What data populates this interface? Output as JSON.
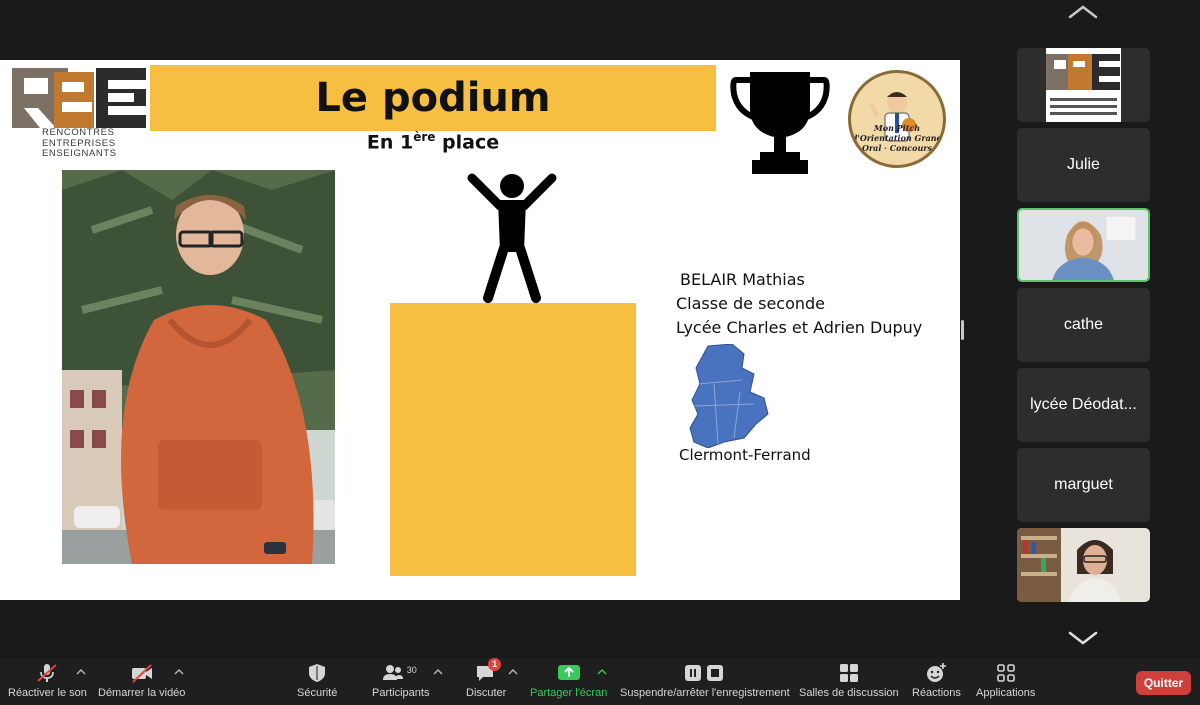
{
  "slide": {
    "title": "Le podium",
    "subtitle_prefix": "En 1",
    "subtitle_sup": "ère",
    "subtitle_suffix": " place",
    "logo_lines": [
      "Rencontres",
      "Entreprises",
      "Enseignants"
    ],
    "badge_text": "Mon Pitch d'Orientation Grand Oral · Concours",
    "info": [
      "BELAIR Mathias",
      "Classe de seconde",
      "Lycée Charles et Adrien Dupuy"
    ],
    "city": "Clermont-Ferrand",
    "accent": "#f6bf41"
  },
  "gallery": {
    "tiles": [
      {
        "type": "logo",
        "label": "R2E"
      },
      {
        "type": "name",
        "label": "Julie"
      },
      {
        "type": "video",
        "label": "speaker-1"
      },
      {
        "type": "name",
        "label": "cathe"
      },
      {
        "type": "name",
        "label": "lycée Déodat..."
      },
      {
        "type": "name",
        "label": "marguet"
      },
      {
        "type": "video",
        "label": "speaker-2"
      }
    ]
  },
  "toolbar": {
    "unmute": "Réactiver le son",
    "start_video": "Démarrer la vidéo",
    "security": "Sécurité",
    "participants": "Participants",
    "participants_count": "30",
    "chat": "Discuter",
    "chat_badge": "1",
    "share": "Partager l'écran",
    "record": "Suspendre/arrêter l'enregistrement",
    "breakout": "Salles de discussion",
    "reactions": "Réactions",
    "apps": "Applications",
    "quit": "Quitter"
  },
  "colors": {
    "green": "#39c95a",
    "red": "#d0403a",
    "tile": "#2d2d2d"
  }
}
